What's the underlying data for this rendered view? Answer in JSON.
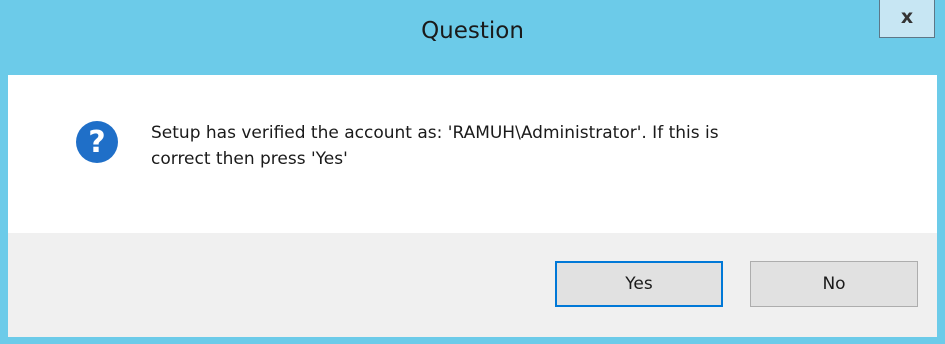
{
  "window": {
    "title": "Question",
    "close_label": "x"
  },
  "dialog": {
    "icon": "question-icon",
    "message_line1": "Setup has verified the account as: 'RAMUH\\Administrator'. If this is",
    "message_line2": "correct then press 'Yes'"
  },
  "buttons": {
    "yes_label": "Yes",
    "no_label": "No"
  },
  "colors": {
    "titlebar": "#6ccbe9",
    "icon": "#1f6fc8",
    "footer": "#f0f0f0",
    "focus": "#0078d7"
  }
}
